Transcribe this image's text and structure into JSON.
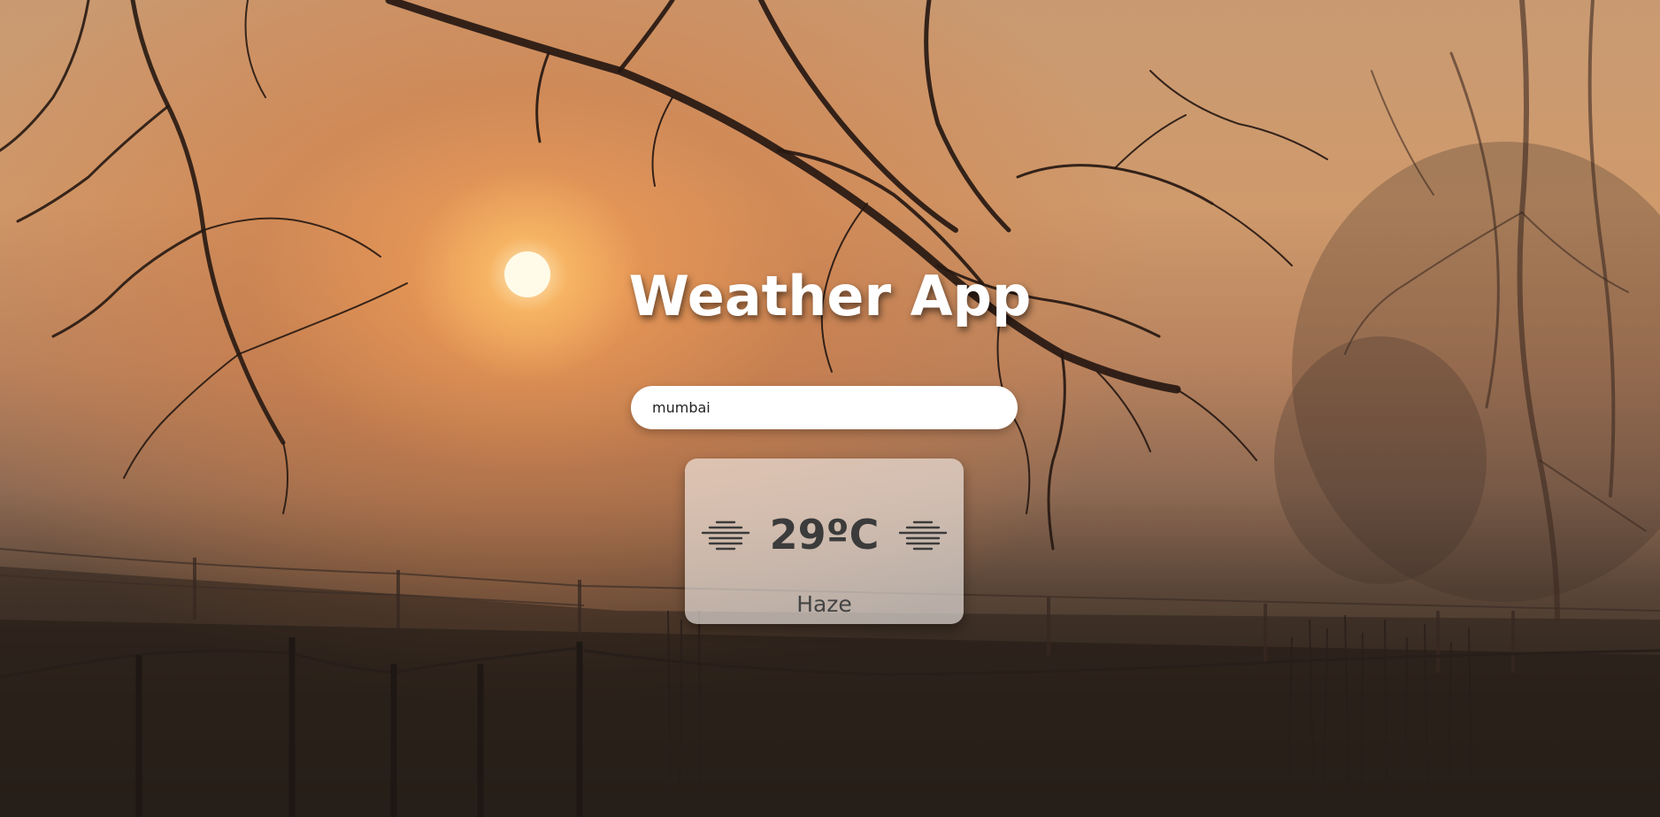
{
  "header": {
    "title": "Weather App"
  },
  "search": {
    "value": "mumbai",
    "placeholder": ""
  },
  "weather": {
    "temperature": "29ºC",
    "condition": "Haze",
    "icon_left": "haze-icon",
    "icon_right": "haze-icon"
  },
  "colors": {
    "title_text": "#ffffff",
    "card_text": "#3b3b3b",
    "input_background": "#ffffff"
  }
}
